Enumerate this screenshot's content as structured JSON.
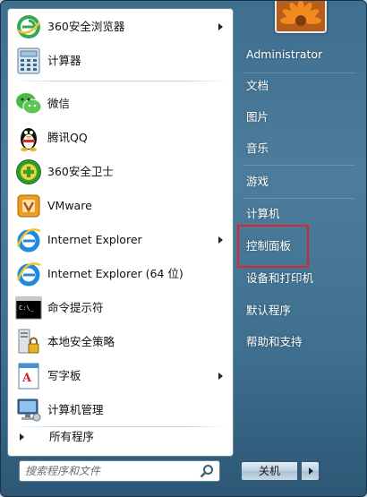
{
  "programs": [
    {
      "label": "360安全浏览器",
      "icon": "360-browser-icon",
      "submenu": true
    },
    {
      "label": "计算器",
      "icon": "calculator-icon",
      "submenu": false
    },
    {
      "label": "微信",
      "icon": "wechat-icon",
      "submenu": false
    },
    {
      "label": "腾讯QQ",
      "icon": "qq-penguin-icon",
      "submenu": false
    },
    {
      "label": "360安全卫士",
      "icon": "360-safe-icon",
      "submenu": false
    },
    {
      "label": "VMware",
      "icon": "vmware-icon",
      "submenu": false
    },
    {
      "label": "Internet Explorer",
      "icon": "internet-explorer-icon",
      "submenu": true
    },
    {
      "label": "Internet Explorer (64 位)",
      "icon": "internet-explorer-icon",
      "submenu": false
    },
    {
      "label": "命令提示符",
      "icon": "command-prompt-icon",
      "submenu": false
    },
    {
      "label": "本地安全策略",
      "icon": "security-policy-icon",
      "submenu": false
    },
    {
      "label": "写字板",
      "icon": "wordpad-icon",
      "submenu": true
    },
    {
      "label": "计算机管理",
      "icon": "computer-management-icon",
      "submenu": false
    }
  ],
  "all_programs_label": "所有程序",
  "search": {
    "placeholder": "搜索程序和文件"
  },
  "right_pane": {
    "user": "Administrator",
    "items": [
      "文档",
      "图片",
      "音乐",
      "游戏",
      "计算机",
      "控制面板",
      "设备和打印机",
      "默认程序",
      "帮助和支持"
    ]
  },
  "shutdown_label": "关机",
  "colors": {
    "highlight_border": "#e0232f",
    "pane_bg": "#ffffff",
    "right_pane_text": "#ffffff"
  }
}
